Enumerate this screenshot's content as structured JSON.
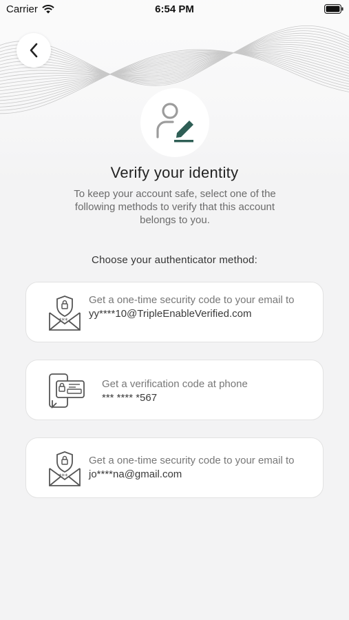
{
  "status_bar": {
    "carrier": "Carrier",
    "time": "6:54 PM"
  },
  "header": {
    "title": "Verify your identity",
    "subtitle": "To keep your account safe, select one of the following methods to verify that this account belongs to you."
  },
  "methods_heading": "Choose your authenticator method:",
  "methods": [
    {
      "icon": "email-shield-icon",
      "text": "Get a one-time security code to your email to",
      "target": "yy****10@TripleEnableVerified.com"
    },
    {
      "icon": "phone-card-icon",
      "text": "Get a verification code at phone",
      "target": "*** **** *567"
    },
    {
      "icon": "email-shield-icon",
      "text": "Get a one-time security code to your email to",
      "target": "jo****na@gmail.com"
    }
  ],
  "colors": {
    "accent": "#2e5e55",
    "background": "#f3f3f4",
    "card": "#ffffff"
  }
}
